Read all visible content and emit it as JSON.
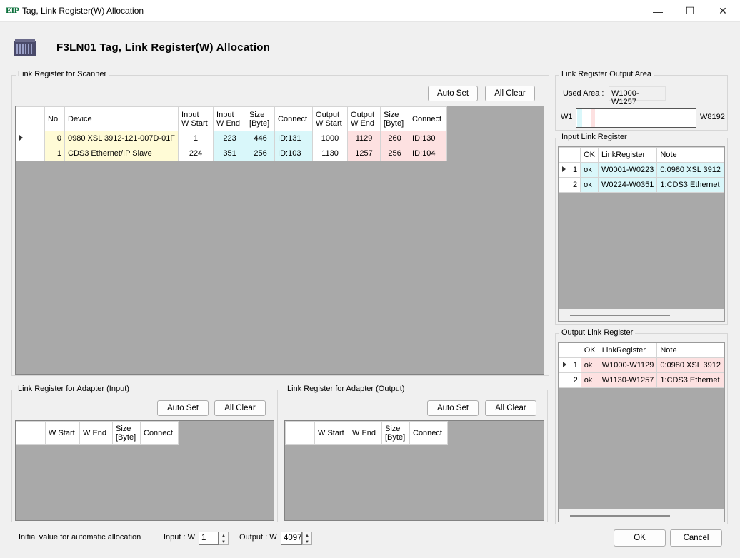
{
  "window": {
    "icon_text": "EIP",
    "title": "Tag, Link Register(W) Allocation",
    "minimize_glyph": "—",
    "maximize_glyph": "☐",
    "close_glyph": "✕"
  },
  "header": {
    "title": "F3LN01   Tag, Link Register(W) Allocation"
  },
  "scanner": {
    "group_label": "Link Register for Scanner",
    "auto_set": "Auto Set",
    "all_clear": "All Clear",
    "columns": [
      "No",
      "Device",
      "Input\nW Start",
      "Input\nW End",
      "Size\n[Byte]",
      "Connect",
      "Output\nW Start",
      "Output\nW End",
      "Size\n[Byte]",
      "Connect"
    ],
    "rows": [
      {
        "no": "0",
        "device": "0980 XSL 3912-121-007D-01F",
        "in_start": "1",
        "in_end": "223",
        "in_size": "446",
        "in_conn": "ID:131",
        "out_start": "1000",
        "out_end": "1129",
        "out_size": "260",
        "out_conn": "ID:130"
      },
      {
        "no": "1",
        "device": "CDS3 Ethernet/IP Slave",
        "in_start": "224",
        "in_end": "351",
        "in_size": "256",
        "in_conn": "ID:103",
        "out_start": "1130",
        "out_end": "1257",
        "out_size": "256",
        "out_conn": "ID:104"
      }
    ]
  },
  "output_area": {
    "group_label": "Link Register Output Area",
    "used_area_label": "Used Area :",
    "used_area_value": "W1000-W1257",
    "bar_start": "W1",
    "bar_end": "W8192"
  },
  "input_link": {
    "group_label": "Input Link Register",
    "columns": [
      "OK",
      "LinkRegister",
      "Note"
    ],
    "rows": [
      {
        "idx": "1",
        "ok": "ok",
        "reg": "W0001-W0223",
        "note": "0:0980 XSL 3912"
      },
      {
        "idx": "2",
        "ok": "ok",
        "reg": "W0224-W0351",
        "note": "1:CDS3 Ethernet"
      }
    ]
  },
  "output_link": {
    "group_label": "Output Link Register",
    "columns": [
      "OK",
      "LinkRegister",
      "Note"
    ],
    "rows": [
      {
        "idx": "1",
        "ok": "ok",
        "reg": "W1000-W1129",
        "note": "0:0980 XSL 3912"
      },
      {
        "idx": "2",
        "ok": "ok",
        "reg": "W1130-W1257",
        "note": "1:CDS3 Ethernet"
      }
    ]
  },
  "adapter_input": {
    "group_label": "Link Register for Adapter (Input)",
    "auto_set": "Auto Set",
    "all_clear": "All Clear",
    "columns": [
      "W Start",
      "W End",
      "Size\n[Byte]",
      "Connect"
    ]
  },
  "adapter_output": {
    "group_label": "Link Register for Adapter (Output)",
    "auto_set": "Auto Set",
    "all_clear": "All Clear",
    "columns": [
      "W Start",
      "W End",
      "Size\n[Byte]",
      "Connect"
    ]
  },
  "footer": {
    "initial_label": "Initial value for automatic allocation",
    "input_label": "Input : W",
    "input_value": "1",
    "output_label": "Output : W",
    "output_value": "4097",
    "ok": "OK",
    "cancel": "Cancel"
  },
  "colors": {
    "grid_bg": "#a9a9a9",
    "device_yellow": "#fffbd6",
    "input_cyan": "#d9f7fa",
    "output_pink": "#fde1e1"
  }
}
